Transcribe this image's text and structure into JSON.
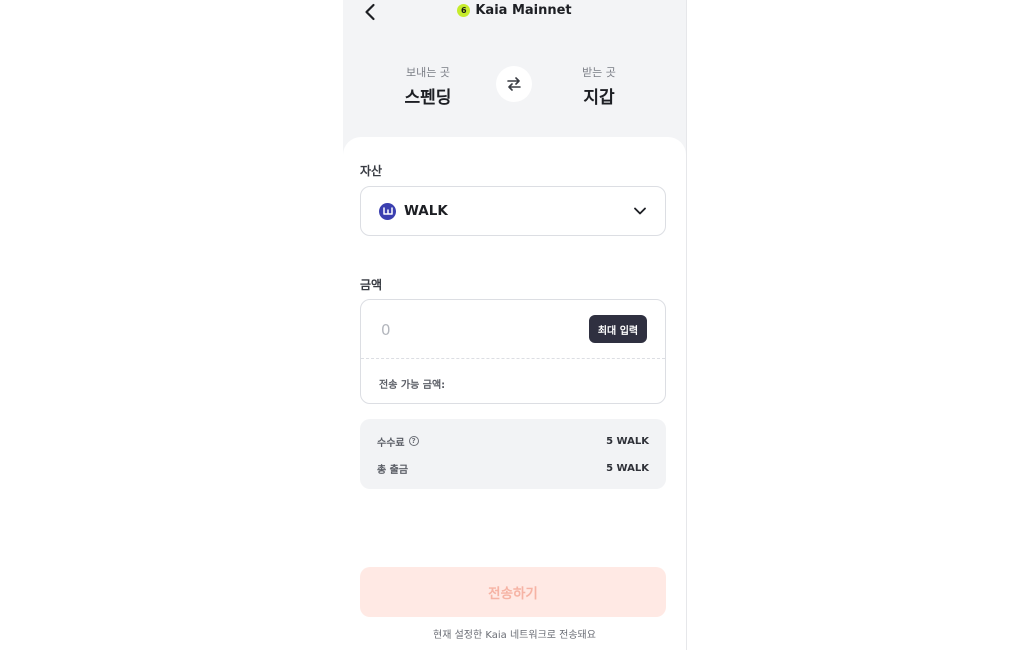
{
  "header": {
    "network_label": "Kaia Mainnet",
    "network_icon_glyph": "6"
  },
  "route": {
    "from_caption": "보내는 곳",
    "from_value": "스펜딩",
    "to_caption": "받는 곳",
    "to_value": "지갑"
  },
  "asset": {
    "label": "자산",
    "selected": "WALK",
    "token_icon_glyph": "ш"
  },
  "amount": {
    "label": "금액",
    "placeholder": "0",
    "max_button": "최대 입력",
    "available_label": "전송 가능 금액:"
  },
  "fees": {
    "fee_label": "수수료",
    "fee_value": "5 WALK",
    "help_glyph": "?",
    "total_label": "총 출금",
    "total_value": "5 WALK"
  },
  "actions": {
    "send_button": "전송하기",
    "network_note": "현재 설정한 Kaia 네트워크로 전송돼요"
  },
  "colors": {
    "accent_disabled_bg": "#ffe9e4",
    "accent_disabled_text": "#f6b3a4",
    "network_icon": "#c6ec2c",
    "token_icon": "#3b3fb0",
    "max_button_bg": "#2f3040"
  }
}
